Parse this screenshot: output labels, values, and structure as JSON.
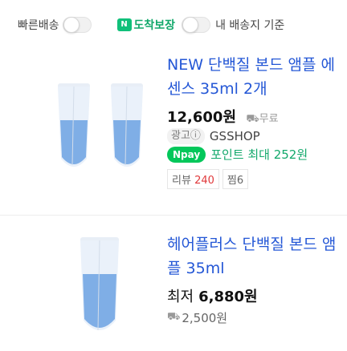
{
  "filters": {
    "fast_delivery_label": "빠른배송",
    "guarantee_icon_text": "N",
    "guarantee_label": "도착보장",
    "my_address_label": "내 배송지 기준"
  },
  "products": [
    {
      "title": "NEW 단백질 본드 앰플 에센스 35ml 2개",
      "price": "12,600원",
      "shipping": "무료",
      "ad_badge": "광고ⓘ",
      "seller": "GSSHOP",
      "npay_label": "Npay",
      "point_text": "포인트 최대 252원",
      "review_label": "리뷰",
      "review_count": "240",
      "wish_label": "찜",
      "wish_count": "6"
    },
    {
      "title": "헤어플러스 단백질 본드 앰플 35ml",
      "price_prefix": "최저",
      "price": "6,880원",
      "shipping_fee": "2,500원"
    }
  ]
}
